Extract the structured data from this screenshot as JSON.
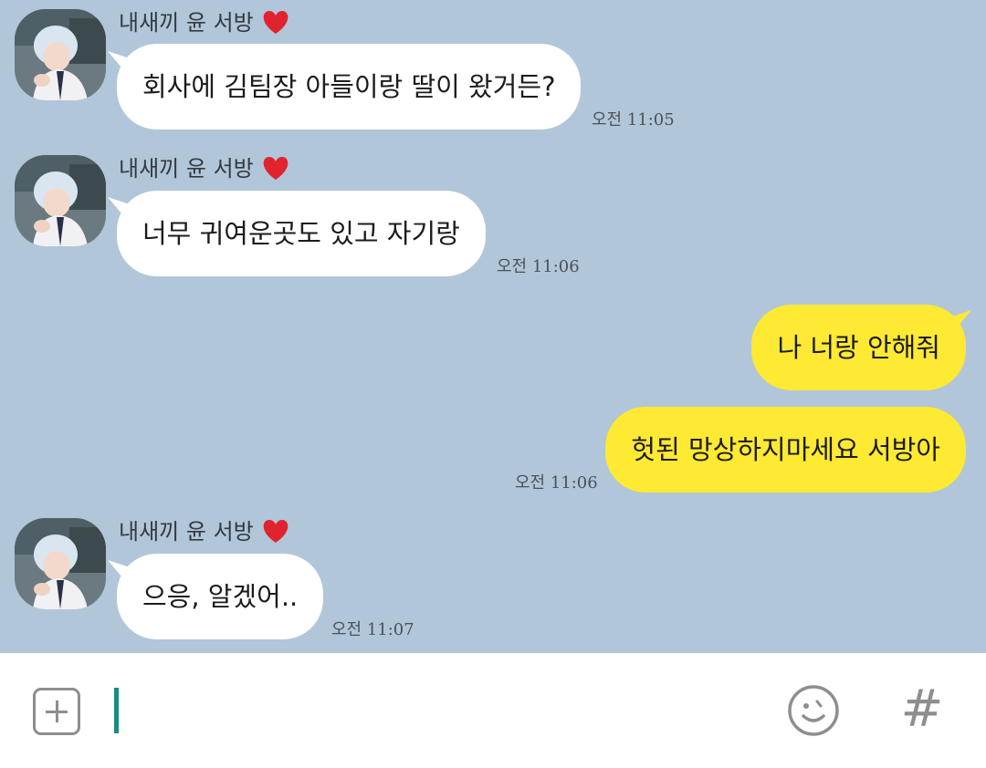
{
  "conversation": {
    "messages": [
      {
        "sender": "내새끼 윤 서방",
        "text": "회사에 김팀장 아들이랑 딸이 왔거든?",
        "time": "오전 11:05"
      },
      {
        "sender": "내새끼 윤 서방",
        "text": "너무 귀여운곳도 있고 자기랑",
        "time": "오전 11:06"
      },
      {
        "text": "나 너랑 안해줘"
      },
      {
        "text": "헛된 망상하지마세요 서방아",
        "time": "오전 11:06"
      },
      {
        "sender": "내새끼 윤 서방",
        "text": "으응, 알겠어..",
        "time": "오전 11:07"
      }
    ]
  },
  "input_bar": {
    "placeholder": "",
    "plus_icon": "plus-square-icon",
    "emoji_icon": "smiley-icon",
    "hash_label": "#"
  },
  "colors": {
    "chat_background": "#b1c6d9",
    "incoming_bubble": "#ffffff",
    "outgoing_bubble": "#fee933",
    "cursor": "#1a8b7d",
    "heart": "#e0232f"
  }
}
